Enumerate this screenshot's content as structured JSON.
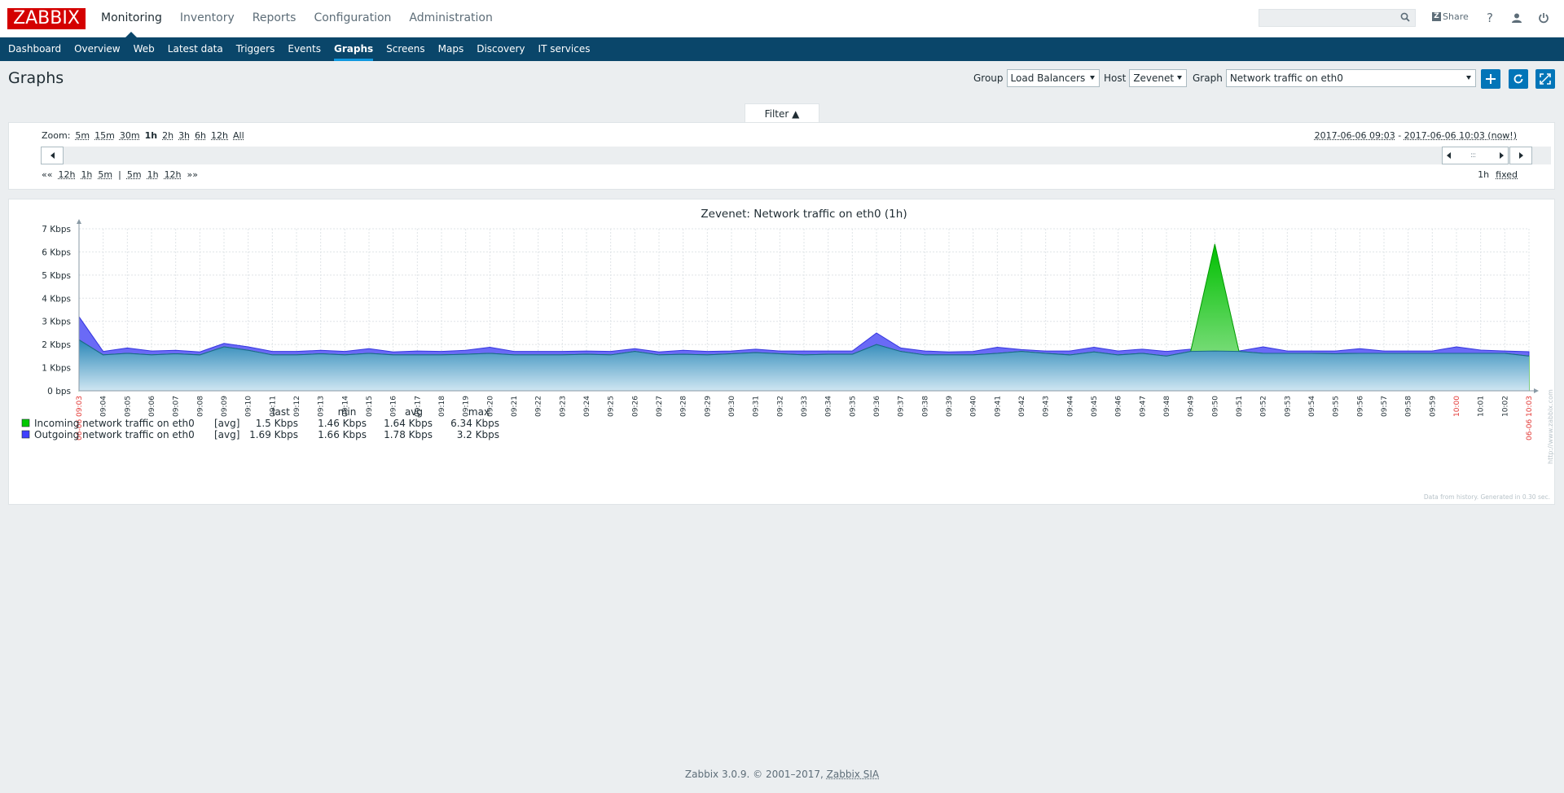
{
  "app": {
    "logo": "ZABBIX"
  },
  "topnav": [
    {
      "label": "Monitoring",
      "active": true
    },
    {
      "label": "Inventory",
      "active": false
    },
    {
      "label": "Reports",
      "active": false
    },
    {
      "label": "Configuration",
      "active": false
    },
    {
      "label": "Administration",
      "active": false
    }
  ],
  "header": {
    "search_value": "",
    "share_label": "Share"
  },
  "subnav": [
    {
      "label": "Dashboard",
      "active": false
    },
    {
      "label": "Overview",
      "active": false
    },
    {
      "label": "Web",
      "active": false
    },
    {
      "label": "Latest data",
      "active": false
    },
    {
      "label": "Triggers",
      "active": false
    },
    {
      "label": "Events",
      "active": false
    },
    {
      "label": "Graphs",
      "active": true
    },
    {
      "label": "Screens",
      "active": false
    },
    {
      "label": "Maps",
      "active": false
    },
    {
      "label": "Discovery",
      "active": false
    },
    {
      "label": "IT services",
      "active": false
    }
  ],
  "page": {
    "title": "Graphs",
    "group_label": "Group",
    "group_value": "Load Balancers",
    "host_label": "Host",
    "host_value": "Zevenet",
    "graph_label": "Graph",
    "graph_value": "Network traffic on eth0"
  },
  "filter": {
    "tab_label": "Filter ▲",
    "zoom_label": "Zoom:",
    "zoom_options": [
      "5m",
      "15m",
      "30m",
      "1h",
      "2h",
      "3h",
      "6h",
      "12h",
      "All"
    ],
    "zoom_current": "1h",
    "period_from": "2017-06-06 09:03",
    "period_sep": " - ",
    "period_to": "2017-06-06 10:03 (now!)",
    "nav_back_far": "«« ",
    "nav_back": [
      "12h",
      "1h",
      "5m"
    ],
    "nav_sep": "|",
    "nav_fwd": [
      "5m",
      "1h",
      "12h"
    ],
    "nav_fwd_far": " »»",
    "period_length": "1h",
    "fixed_label": "fixed"
  },
  "chart_data": {
    "type": "area",
    "title": "Zevenet: Network traffic on eth0 (1h)",
    "ylabel": "",
    "y_ticks": [
      "0 bps",
      "1 Kbps",
      "2 Kbps",
      "3 Kbps",
      "4 Kbps",
      "5 Kbps",
      "6 Kbps",
      "7 Kbps"
    ],
    "ylim": [
      0,
      7
    ],
    "y_unit": "Kbps",
    "x_start_label": "06-06 09:03",
    "x_end_label": "06-06 10:03",
    "x_labels": [
      "09:04",
      "09:05",
      "09:06",
      "09:07",
      "09:08",
      "09:09",
      "09:10",
      "09:11",
      "09:12",
      "09:13",
      "09:14",
      "09:15",
      "09:16",
      "09:17",
      "09:18",
      "09:19",
      "09:20",
      "09:21",
      "09:22",
      "09:23",
      "09:24",
      "09:25",
      "09:26",
      "09:27",
      "09:28",
      "09:29",
      "09:30",
      "09:31",
      "09:32",
      "09:33",
      "09:34",
      "09:35",
      "09:36",
      "09:37",
      "09:38",
      "09:39",
      "09:40",
      "09:41",
      "09:42",
      "09:43",
      "09:44",
      "09:45",
      "09:46",
      "09:47",
      "09:48",
      "09:49",
      "09:50",
      "09:51",
      "09:52",
      "09:53",
      "09:54",
      "09:55",
      "09:56",
      "09:57",
      "09:58",
      "09:59",
      "10:00",
      "10:01",
      "10:02"
    ],
    "x_highlight": [
      "10:00"
    ],
    "x": [
      0,
      1,
      2,
      3,
      4,
      5,
      6,
      7,
      8,
      9,
      10,
      11,
      12,
      13,
      14,
      15,
      16,
      17,
      18,
      19,
      20,
      21,
      22,
      23,
      24,
      25,
      26,
      27,
      28,
      29,
      30,
      31,
      32,
      33,
      34,
      35,
      36,
      37,
      38,
      39,
      40,
      41,
      42,
      43,
      44,
      45,
      46,
      47,
      48,
      49,
      50,
      51,
      52,
      53,
      54,
      55,
      56,
      57,
      58,
      59,
      60
    ],
    "series": [
      {
        "name": "Incoming network traffic on eth0",
        "color": "#00c800",
        "func": "[avg]",
        "last": "1.5 Kbps",
        "min": "1.46 Kbps",
        "avg": "1.64 Kbps",
        "max": "6.34 Kbps",
        "values": [
          2.2,
          1.55,
          1.62,
          1.55,
          1.6,
          1.55,
          1.9,
          1.75,
          1.55,
          1.55,
          1.6,
          1.55,
          1.62,
          1.55,
          1.55,
          1.55,
          1.58,
          1.62,
          1.55,
          1.55,
          1.55,
          1.58,
          1.55,
          1.7,
          1.55,
          1.58,
          1.55,
          1.6,
          1.65,
          1.6,
          1.55,
          1.58,
          1.58,
          2.0,
          1.7,
          1.55,
          1.55,
          1.55,
          1.62,
          1.7,
          1.62,
          1.55,
          1.68,
          1.55,
          1.62,
          1.5,
          1.7,
          6.34,
          1.7,
          1.62,
          1.62,
          1.62,
          1.6,
          1.62,
          1.62,
          1.62,
          1.62,
          1.62,
          1.62,
          1.62,
          1.5
        ]
      },
      {
        "name": "Outgoing network traffic on eth0",
        "color": "#4040ff",
        "func": "[avg]",
        "last": "1.69 Kbps",
        "min": "1.66 Kbps",
        "avg": "1.78 Kbps",
        "max": "3.2 Kbps",
        "values": [
          3.2,
          1.7,
          1.85,
          1.72,
          1.75,
          1.68,
          2.05,
          1.9,
          1.7,
          1.7,
          1.75,
          1.7,
          1.82,
          1.68,
          1.72,
          1.7,
          1.75,
          1.88,
          1.7,
          1.7,
          1.7,
          1.72,
          1.7,
          1.82,
          1.68,
          1.75,
          1.7,
          1.72,
          1.8,
          1.72,
          1.72,
          1.72,
          1.72,
          2.5,
          1.85,
          1.72,
          1.68,
          1.7,
          1.88,
          1.78,
          1.72,
          1.72,
          1.88,
          1.72,
          1.8,
          1.7,
          1.8,
          1.72,
          1.72,
          1.9,
          1.72,
          1.72,
          1.72,
          1.82,
          1.72,
          1.72,
          1.72,
          1.9,
          1.76,
          1.72,
          1.69
        ]
      }
    ],
    "legend_headers": [
      "last",
      "min",
      "avg",
      "max"
    ],
    "generated_note": "Data from history. Generated in 0.30 sec.",
    "watermark": "http://www.zabbix.com",
    "grid": true
  },
  "footer": {
    "text": "Zabbix 3.0.9. © 2001–2017, ",
    "link": "Zabbix SIA"
  }
}
